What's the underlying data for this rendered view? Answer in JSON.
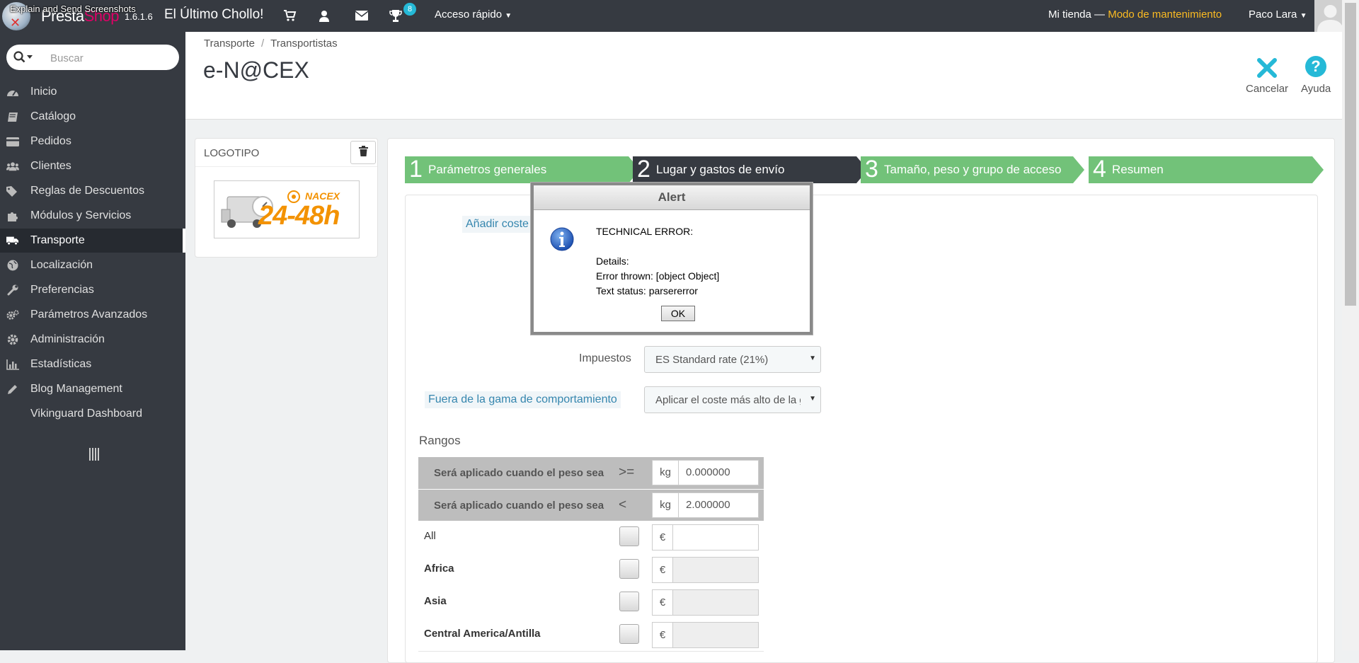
{
  "topbar": {
    "overlay_label": "Explain and Send Screenshots",
    "logo_presta": "Presta",
    "logo_shop": "Shop",
    "version": "1.6.1.6",
    "shop_name": "El Último Chollo!",
    "badge_count": "8",
    "quick_access": "Acceso rápido",
    "my_store": "Mi tienda",
    "dash": "—",
    "maintenance": "Modo de mantenimiento",
    "user_name": "Paco Lara",
    "accent_color": "#25b9d7",
    "maintenance_color": "#fbbb22"
  },
  "sidebar": {
    "search_placeholder": "Buscar",
    "items": [
      {
        "label": "Inicio",
        "icon": "dashboard-icon"
      },
      {
        "label": "Catálogo",
        "icon": "book-icon"
      },
      {
        "label": "Pedidos",
        "icon": "credit-card-icon"
      },
      {
        "label": "Clientes",
        "icon": "users-icon"
      },
      {
        "label": "Reglas de Descuentos",
        "icon": "tags-icon"
      },
      {
        "label": "Módulos y Servicios",
        "icon": "puzzle-icon"
      },
      {
        "label": "Transporte",
        "icon": "truck-icon",
        "active": true
      },
      {
        "label": "Localización",
        "icon": "globe-icon"
      },
      {
        "label": "Preferencias",
        "icon": "wrench-icon"
      },
      {
        "label": "Parámetros Avanzados",
        "icon": "cogs-icon"
      },
      {
        "label": "Administración",
        "icon": "cog-icon"
      },
      {
        "label": "Estadísticas",
        "icon": "bar-chart-icon"
      },
      {
        "label": "Blog Management",
        "icon": "pencil-icon"
      },
      {
        "label": "Vikinguard Dashboard",
        "icon": ""
      }
    ]
  },
  "header": {
    "breadcrumb": [
      "Transporte",
      "Transportistas"
    ],
    "breadcrumb_sep": "/",
    "title": "e-N@CEX",
    "cancel_label": "Cancelar",
    "help_label": "Ayuda"
  },
  "logo_panel": {
    "title": "LOGOTIPO",
    "brand_text": "NACEX",
    "image_text": "24-48h"
  },
  "steps": [
    {
      "num": "1",
      "label": "Parámetros generales",
      "state": "done"
    },
    {
      "num": "2",
      "label": "Lugar y gastos de envío",
      "state": "active"
    },
    {
      "num": "3",
      "label": "Tamaño, peso y grupo de acceso",
      "state": "todo"
    },
    {
      "num": "4",
      "label": "Resumen",
      "state": "todo"
    }
  ],
  "form": {
    "add_cost_label": "Añadir coste",
    "tax_label": "Impuestos",
    "tax_value": "ES Standard rate (21%)",
    "out_of_range_label": "Fuera de la gama de comportamiento",
    "out_of_range_value": "Aplicar el coste más alto de la gama definida",
    "ranges_title": "Rangos",
    "range_rows": [
      {
        "label": "Será aplicado cuando el peso sea",
        "op": ">=",
        "unit": "kg",
        "value": "0.000000"
      },
      {
        "label": "Será aplicado cuando el peso sea",
        "op": "<",
        "unit": "kg",
        "value": "2.000000"
      }
    ],
    "zones": [
      {
        "label": "All",
        "bold": false,
        "currency": "€",
        "disabled": false
      },
      {
        "label": "Africa",
        "bold": true,
        "currency": "€",
        "disabled": true
      },
      {
        "label": "Asia",
        "bold": true,
        "currency": "€",
        "disabled": true
      },
      {
        "label": "Central America/Antilla",
        "bold": true,
        "currency": "€",
        "disabled": true
      }
    ]
  },
  "alert": {
    "title": "Alert",
    "line1": "TECHNICAL ERROR:",
    "line2": "Details:",
    "line3": "Error thrown: [object Object]",
    "line4": "Text status: parsererror",
    "ok_label": "OK"
  }
}
